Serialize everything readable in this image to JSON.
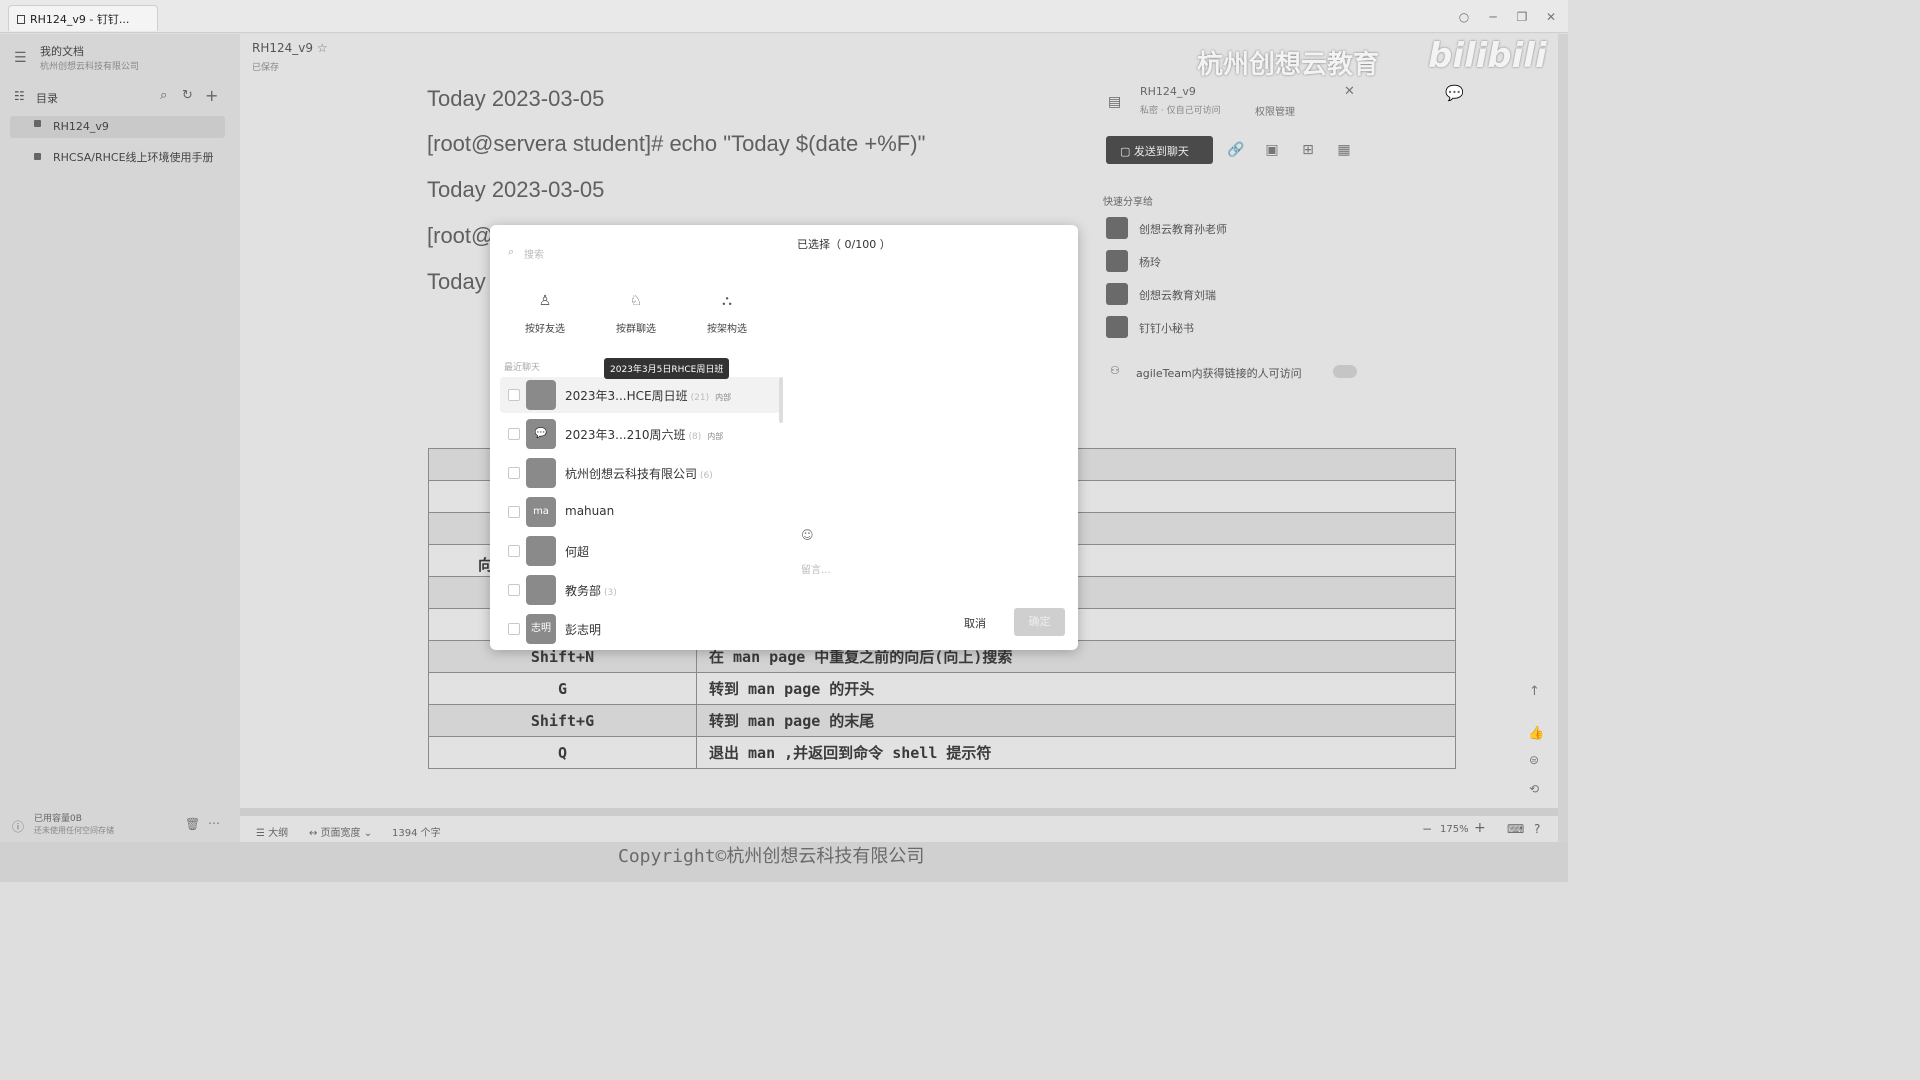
{
  "window": {
    "tab_title": "RH124_v9 - 钉钉...",
    "controls": [
      "○",
      "─",
      "❐",
      "✕"
    ]
  },
  "sidebar": {
    "title": "我的文档",
    "subtitle": "杭州创想云科技有限公司",
    "toc_label": "目录",
    "items": [
      {
        "label": "RH124_v9"
      },
      {
        "label": "RHCSA/RHCE线上环境使用手册"
      }
    ],
    "storage_label": "已用容量0B",
    "storage_sub": "还未使用任何空间存储"
  },
  "doc_header": {
    "title": "RH124_v9",
    "status": "已保存"
  },
  "watermark": {
    "brand": "杭州创想云教育",
    "logo": "bilibili"
  },
  "doc": {
    "lines": [
      "Today 2023-03-05",
      "[root@servera student]# echo \"Today $(date +%F)\"",
      "Today 2023-03-05",
      "[root@",
      "Today"
    ],
    "partial_cell": "向",
    "table": [
      [
        "",
        ""
      ],
      [
        "",
        ""
      ],
      [
        "",
        ""
      ],
      [
        "",
        ""
      ],
      [
        "",
        ""
      ],
      [
        "",
        ""
      ],
      [
        "Shift+N",
        "在 man page 中重复之前的向后(向上)搜索"
      ],
      [
        "G",
        "转到 man page 的开头"
      ],
      [
        "Shift+G",
        "转到 man page 的末尾"
      ],
      [
        "Q",
        "退出 man ,并返回到命令 shell 提示符"
      ]
    ]
  },
  "share_panel": {
    "title": "RH124_v9",
    "subtitle": "私密 · 仅自己可访问",
    "permission_link": "权限管理",
    "send_button": "发送到聊天",
    "quick_share_label": "快速分享给",
    "contacts": [
      {
        "name": "创想云教育孙老师"
      },
      {
        "name": "杨玲"
      },
      {
        "name": "创想云教育刘瑞"
      },
      {
        "name": "钉钉小秘书"
      }
    ],
    "link_access": "agileTeam内获得链接的人可访问"
  },
  "modal": {
    "search_placeholder": "搜索",
    "selected_label": "已选择（ 0/100 ）",
    "filters": [
      {
        "label": "按好友选"
      },
      {
        "label": "按群聊选"
      },
      {
        "label": "按架构选"
      }
    ],
    "recent_label": "最近聊天",
    "tooltip": "2023年3月5日RHCE周日班",
    "chats": [
      {
        "name": "2023年3...HCE周日班",
        "count": "(21)",
        "tag": "内部",
        "avatar": ""
      },
      {
        "name": "2023年3...210周六班",
        "count": "(8)",
        "tag": "内部",
        "avatar": "💬"
      },
      {
        "name": "杭州创想云科技有限公司",
        "count": "(6)",
        "tag": "",
        "avatar": ""
      },
      {
        "name": "mahuan",
        "count": "",
        "tag": "",
        "avatar": "ma"
      },
      {
        "name": "何超",
        "count": "",
        "tag": "",
        "avatar": ""
      },
      {
        "name": "教务部",
        "count": "(3)",
        "tag": "",
        "avatar": ""
      },
      {
        "name": "彭志明",
        "count": "",
        "tag": "",
        "avatar": "志明"
      }
    ],
    "message_placeholder": "留言...",
    "cancel_label": "取消",
    "confirm_label": "确定"
  },
  "status_bar": {
    "outline": "大纲",
    "page_width": "页面宽度",
    "word_count": "1394 个字",
    "zoom": "175%"
  },
  "copyright": "Copyright©杭州创想云科技有限公司",
  "colors": {
    "primary_button": "#4a4a4a",
    "disabled_button": "#cfcfcf"
  }
}
